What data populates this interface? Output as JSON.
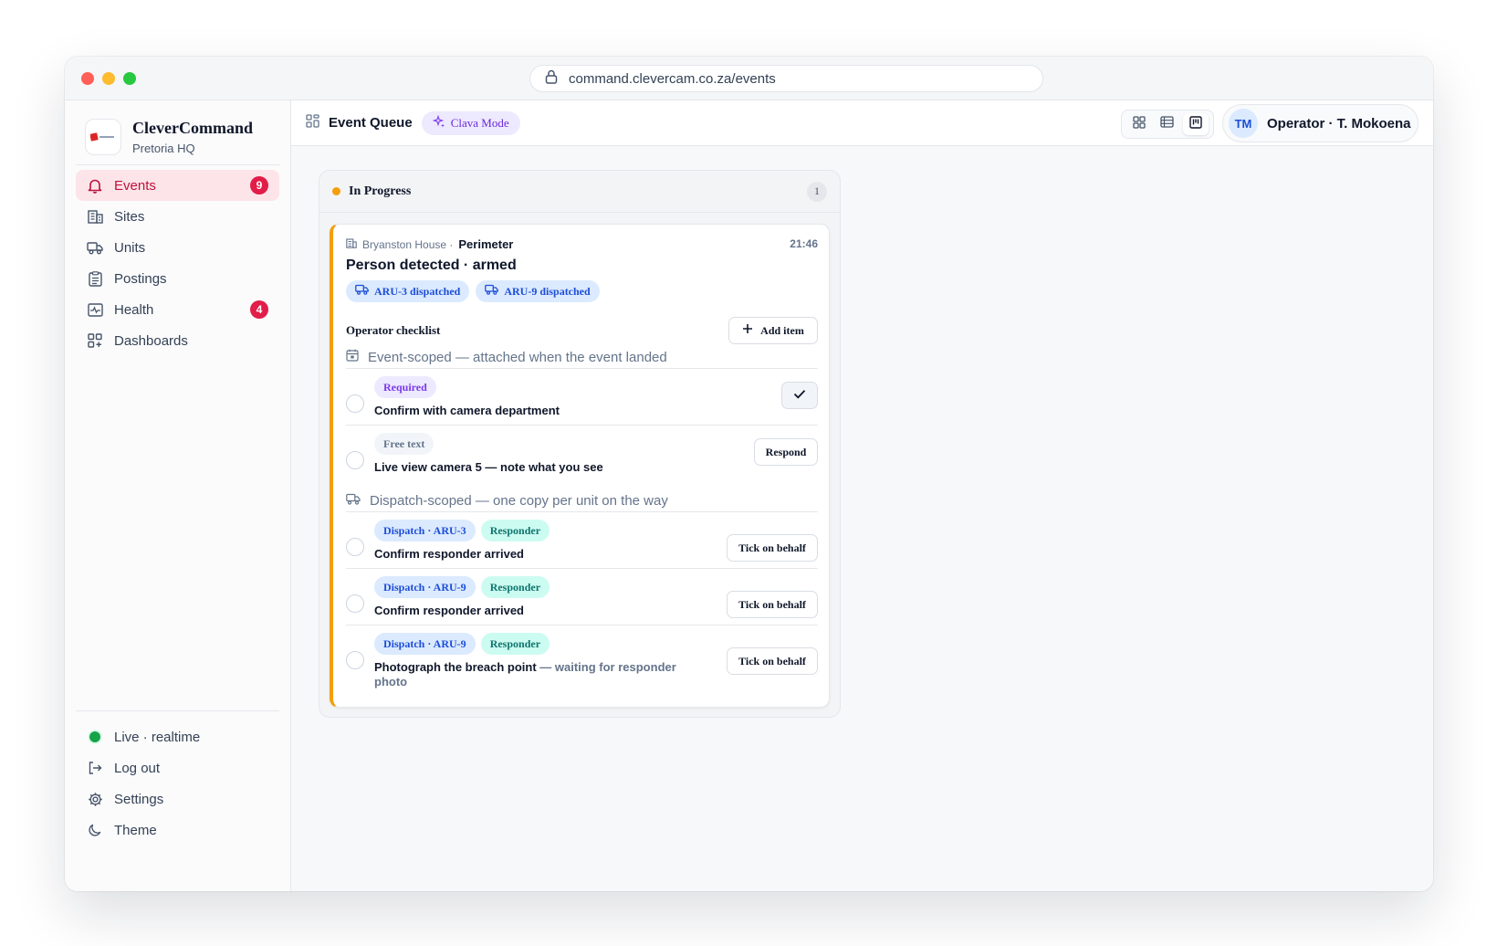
{
  "browser": {
    "url": "command.clevercam.co.za/events"
  },
  "sidebar": {
    "brand_name": "CleverCommand",
    "brand_sub": "Pretoria HQ",
    "items": [
      {
        "label": "Events",
        "icon": "bell-icon",
        "badge": "9",
        "active": true
      },
      {
        "label": "Sites",
        "icon": "building-icon"
      },
      {
        "label": "Units",
        "icon": "truck-icon"
      },
      {
        "label": "Postings",
        "icon": "clipboard-icon"
      },
      {
        "label": "Health",
        "icon": "pulse-icon",
        "badge": "4"
      },
      {
        "label": "Dashboards",
        "icon": "dashboard-icon"
      }
    ],
    "bottom": {
      "live": "Live · realtime",
      "logout": "Log out",
      "settings": "Settings",
      "theme": "Theme"
    }
  },
  "topbar": {
    "title": "Event Queue",
    "mode": "Clava Mode",
    "operator_initials": "TM",
    "operator_name": "Operator · T. Mokoena"
  },
  "column": {
    "title": "In Progress",
    "count": "1",
    "status_color": "#f59e0b"
  },
  "event": {
    "site": "Bryanston House ·",
    "zone": "Perimeter",
    "time": "21:46",
    "title": "Person detected · armed",
    "dispatches": [
      "ARU-3 dispatched",
      "ARU-9 dispatched"
    ],
    "checklist": {
      "title": "Operator checklist",
      "add_label": "Add item",
      "event_scope": "Event-scoped — attached when the event landed",
      "dispatch_scope": "Dispatch-scoped — one copy per unit on the way",
      "event_tasks": [
        {
          "tag": "Required",
          "label": "Confirm with camera department"
        },
        {
          "tag": "Free text",
          "label": "Live view camera 5 — note what you see",
          "action": "Respond"
        }
      ],
      "dispatch_tasks": [
        {
          "tag": "Dispatch · ARU-3",
          "role": "Responder",
          "label": "Confirm responder arrived",
          "action": "Tick on behalf"
        },
        {
          "tag": "Dispatch · ARU-9",
          "role": "Responder",
          "label": "Confirm responder arrived",
          "action": "Tick on behalf"
        },
        {
          "tag": "Dispatch · ARU-9",
          "role": "Responder",
          "label": "Photograph the breach point",
          "label_muted": " — waiting for responder photo",
          "action": "Tick on behalf"
        }
      ]
    }
  },
  "colors": {
    "accent_active": "#be123c",
    "badge": "#e11d48",
    "in_progress": "#f59e0b",
    "live": "#16a34a"
  }
}
